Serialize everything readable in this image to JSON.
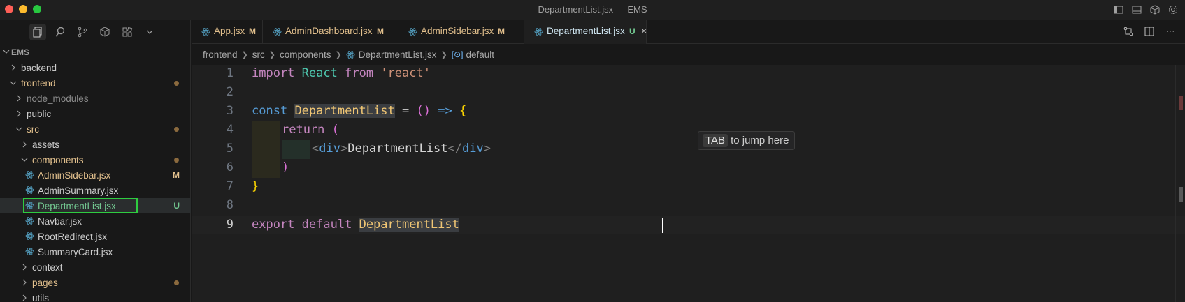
{
  "window": {
    "title": "DepartmentList.jsx — EMS"
  },
  "explorer": {
    "root": "EMS",
    "items": [
      {
        "label": "backend",
        "type": "folder",
        "expanded": false,
        "depth": 0
      },
      {
        "label": "frontend",
        "type": "folder",
        "expanded": true,
        "depth": 0,
        "dot": true
      },
      {
        "label": "node_modules",
        "type": "folder",
        "expanded": false,
        "depth": 1
      },
      {
        "label": "public",
        "type": "folder",
        "expanded": false,
        "depth": 1
      },
      {
        "label": "src",
        "type": "folder",
        "expanded": true,
        "depth": 1,
        "dot": true
      },
      {
        "label": "assets",
        "type": "folder",
        "expanded": false,
        "depth": 2
      },
      {
        "label": "components",
        "type": "folder",
        "expanded": true,
        "depth": 2,
        "dot": true
      },
      {
        "label": "AdminSidebar.jsx",
        "type": "file",
        "depth": 3,
        "badge": "M"
      },
      {
        "label": "AdminSummary.jsx",
        "type": "file",
        "depth": 3
      },
      {
        "label": "DepartmentList.jsx",
        "type": "file",
        "depth": 3,
        "badge": "U",
        "selected": true
      },
      {
        "label": "Navbar.jsx",
        "type": "file",
        "depth": 3
      },
      {
        "label": "RootRedirect.jsx",
        "type": "file",
        "depth": 3
      },
      {
        "label": "SummaryCard.jsx",
        "type": "file",
        "depth": 3
      },
      {
        "label": "context",
        "type": "folder",
        "expanded": false,
        "depth": 2
      },
      {
        "label": "pages",
        "type": "folder",
        "expanded": false,
        "depth": 2,
        "dot": true
      },
      {
        "label": "utils",
        "type": "folder",
        "expanded": false,
        "depth": 2
      }
    ]
  },
  "tabs": [
    {
      "label": "App.jsx",
      "status": "M"
    },
    {
      "label": "AdminDashboard.jsx",
      "status": "M"
    },
    {
      "label": "AdminSidebar.jsx",
      "status": "M"
    },
    {
      "label": "DepartmentList.jsx",
      "status": "U",
      "active": true,
      "close": "×"
    }
  ],
  "breadcrumb": [
    "frontend",
    "src",
    "components",
    "DepartmentList.jsx",
    "default"
  ],
  "editor": {
    "line_numbers": [
      "1",
      "2",
      "3",
      "4",
      "5",
      "6",
      "7",
      "8",
      "9"
    ],
    "hint_key": "TAB",
    "hint_text": "to jump here"
  },
  "colors": {
    "modified": "#e2c08d",
    "untracked": "#73c991",
    "selection_outline": "#2ecc40"
  }
}
